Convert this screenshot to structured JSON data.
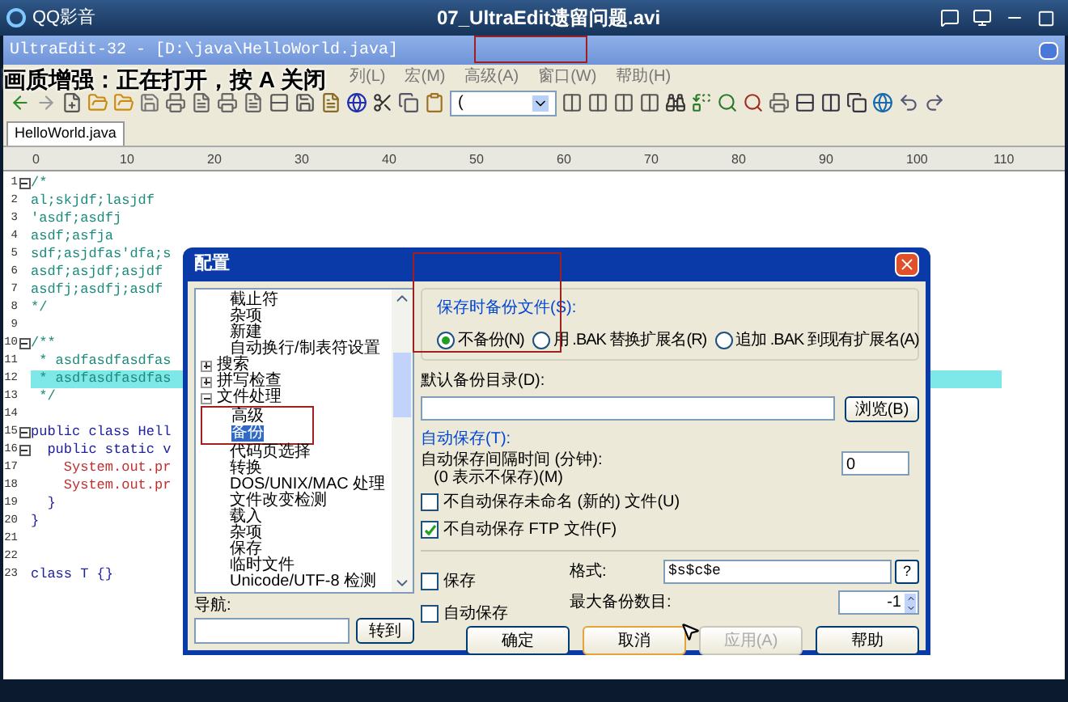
{
  "player": {
    "app_name": "QQ影音",
    "title": "07_UltraEdit遗留问题.avi"
  },
  "overlay_notice": "画质增强：正在打开，按 A 关闭",
  "editor": {
    "title": "UltraEdit-32 - [D:\\java\\HelloWorld.java]",
    "menu": [
      "列(L)",
      "宏(M)",
      "高级(A)",
      "窗口(W)",
      "帮助(H)"
    ],
    "toolbar_dropdown": "(",
    "tabs": [
      {
        "label": "HelloWorld.java",
        "selected": true
      }
    ],
    "ruler": [
      "0",
      "10",
      "20",
      "30",
      "40",
      "50",
      "60",
      "70",
      "80",
      "90",
      "100",
      "110"
    ],
    "lines": [
      {
        "number": "1",
        "text": "/*",
        "expanded": true,
        "kind": "comment",
        "selected": false
      },
      {
        "number": "2",
        "text": "al;skjdf;lasjdf",
        "kind": "comment",
        "selected": false
      },
      {
        "number": "3",
        "text": "'asdf;asdfj",
        "kind": "comment",
        "selected": false
      },
      {
        "number": "4",
        "text": "asdf;asfja",
        "kind": "comment",
        "selected": false
      },
      {
        "number": "5",
        "text": "sdf;asjdfas'dfa;s",
        "kind": "comment",
        "selected": false
      },
      {
        "number": "6",
        "text": "asdf;asjdf;asjdf",
        "kind": "comment",
        "selected": false
      },
      {
        "number": "7",
        "text": "asdfj;asdfj;asdf",
        "kind": "comment",
        "selected": false
      },
      {
        "number": "8",
        "text": "*/",
        "kind": "comment",
        "selected": false
      },
      {
        "number": "9",
        "kind": "code",
        "selected": false
      },
      {
        "number": "10",
        "text": "/**",
        "expanded": true,
        "kind": "comment",
        "selected": false
      },
      {
        "number": "11",
        "text": " * asdfasdfasdfas",
        "kind": "comment",
        "selected": false
      },
      {
        "number": "12",
        "text": " * asdfasdfasdfas",
        "kind": "comment",
        "selected": true
      },
      {
        "number": "13",
        "text": " */",
        "kind": "comment",
        "selected": false
      },
      {
        "number": "14",
        "kind": "code",
        "selected": false
      },
      {
        "number": "15",
        "text": "public class Hell",
        "expanded": true,
        "kind": "code",
        "selected": false
      },
      {
        "number": "16",
        "text": "  public static v",
        "expanded": true,
        "kind": "code",
        "selected": false
      },
      {
        "number": "17",
        "text": "    System.out.pr",
        "kind": "call",
        "selected": false
      },
      {
        "number": "18",
        "text": "    System.out.pr",
        "kind": "call",
        "selected": false
      },
      {
        "number": "19",
        "text": "  }",
        "kind": "code",
        "selected": false
      },
      {
        "number": "20",
        "text": "}",
        "kind": "code",
        "selected": false
      },
      {
        "number": "21",
        "kind": "code",
        "selected": false
      },
      {
        "number": "22",
        "kind": "code",
        "selected": false
      },
      {
        "number": "23",
        "text": "class T {}",
        "kind": "code",
        "selected": false
      }
    ]
  },
  "dialog": {
    "title": "配置",
    "tree": {
      "continued_items": [
        {
          "label": "截止符"
        },
        {
          "label": "杂项"
        },
        {
          "label": "新建"
        },
        {
          "label": "自动换行/制表符设置"
        }
      ],
      "items": [
        {
          "label": "搜索",
          "expanded": false
        },
        {
          "label": "拼写检查",
          "expanded": false
        },
        {
          "label": "文件处理",
          "expanded": true,
          "children": [
            {
              "label": "高级",
              "selected": false,
              "framed": true
            },
            {
              "label": "备份",
              "selected": true,
              "framed": true
            },
            {
              "label": "代码页选择",
              "selected": false,
              "framed": false
            },
            {
              "label": "转换",
              "selected": false,
              "framed": false
            },
            {
              "label": "DOS/UNIX/MAC 处理",
              "selected": false,
              "framed": false
            },
            {
              "label": "文件改变检测",
              "selected": false,
              "framed": false
            },
            {
              "label": "载入",
              "selected": false,
              "framed": false
            },
            {
              "label": "杂项",
              "selected": false,
              "framed": false
            },
            {
              "label": "保存",
              "selected": false,
              "framed": false
            },
            {
              "label": "临时文件",
              "selected": false,
              "framed": false
            },
            {
              "label": "Unicode/UTF-8 检测",
              "selected": false,
              "framed": false
            }
          ]
        }
      ]
    },
    "navigation": {
      "label": "导航:",
      "button": "转到"
    },
    "backup_group": {
      "label": "保存时备份文件(S):",
      "options": [
        {
          "label": "不备份(N)",
          "selected": true
        },
        {
          "label": "用 .BAK 替换扩展名(R)",
          "selected": false
        },
        {
          "label": "追加 .BAK 到现有扩展名(A)",
          "selected": false
        }
      ]
    },
    "default_dir": {
      "label": "默认备份目录(D):",
      "button": "浏览(B)"
    },
    "autosave": {
      "label": "自动保存(T):",
      "interval_label": "自动保存间隔时间 (分钟):",
      "interval_hint": "(0 表示不保存)(M)",
      "interval_value": "0",
      "checks": [
        {
          "label": "不自动保存未命名 (新的) 文件(U)",
          "checked": false
        },
        {
          "label": "不自动保存 FTP 文件(F)",
          "checked": true
        }
      ]
    },
    "bottom_checks": [
      {
        "label": "保存",
        "checked": false
      },
      {
        "label": "自动保存",
        "checked": false
      }
    ],
    "format": {
      "label": "格式:",
      "value": "$s$c$e",
      "help": "?"
    },
    "max_backups": {
      "label": "最大备份数目:",
      "value": "-1"
    },
    "buttons": [
      {
        "label": "确定",
        "disabled": false,
        "focused": false
      },
      {
        "label": "取消",
        "disabled": false,
        "focused": true
      },
      {
        "label": "应用(A)",
        "disabled": true,
        "focused": false
      },
      {
        "label": "帮助",
        "disabled": false,
        "focused": false
      }
    ]
  }
}
